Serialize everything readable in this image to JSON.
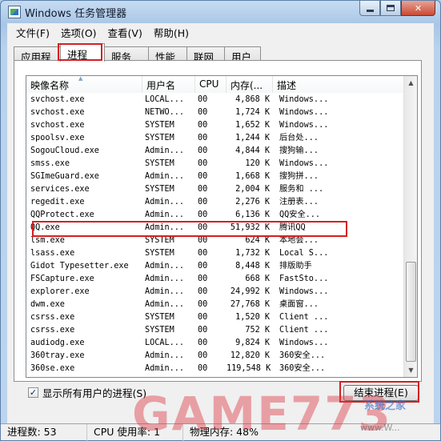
{
  "window": {
    "title": "Windows 任务管理器",
    "minimize_label": "",
    "close_label": "✕"
  },
  "menu": [
    "文件(F)",
    "选项(O)",
    "查看(V)",
    "帮助(H)"
  ],
  "tabs": [
    "应用程序",
    "进程",
    "服务",
    "性能",
    "联网",
    "用户"
  ],
  "active_tab": "进程",
  "columns": [
    "映像名称",
    "用户名",
    "CPU",
    "内存(...",
    "描述"
  ],
  "processes": [
    {
      "name": "svchost.exe",
      "user": "LOCAL...",
      "cpu": "00",
      "mem": "4,868 K",
      "desc": "Windows..."
    },
    {
      "name": "svchost.exe",
      "user": "NETWO...",
      "cpu": "00",
      "mem": "1,724 K",
      "desc": "Windows..."
    },
    {
      "name": "svchost.exe",
      "user": "SYSTEM",
      "cpu": "00",
      "mem": "1,652 K",
      "desc": "Windows..."
    },
    {
      "name": "spoolsv.exe",
      "user": "SYSTEM",
      "cpu": "00",
      "mem": "1,244 K",
      "desc": "后台处..."
    },
    {
      "name": "SogouCloud.exe",
      "user": "Admin...",
      "cpu": "00",
      "mem": "4,844 K",
      "desc": "搜狗输..."
    },
    {
      "name": "smss.exe",
      "user": "SYSTEM",
      "cpu": "00",
      "mem": "120 K",
      "desc": "Windows..."
    },
    {
      "name": "SGImeGuard.exe",
      "user": "Admin...",
      "cpu": "00",
      "mem": "1,668 K",
      "desc": "搜狗拼..."
    },
    {
      "name": "services.exe",
      "user": "SYSTEM",
      "cpu": "00",
      "mem": "2,004 K",
      "desc": "服务和 ..."
    },
    {
      "name": "regedit.exe",
      "user": "Admin...",
      "cpu": "00",
      "mem": "2,276 K",
      "desc": "注册表..."
    },
    {
      "name": "QQProtect.exe",
      "user": "Admin...",
      "cpu": "00",
      "mem": "6,136 K",
      "desc": "QQ安全..."
    },
    {
      "name": "QQ.exe",
      "user": "Admin...",
      "cpu": "00",
      "mem": "51,932 K",
      "desc": "腾讯QQ"
    },
    {
      "name": "lsm.exe",
      "user": "SYSTEM",
      "cpu": "00",
      "mem": "624 K",
      "desc": "本地会..."
    },
    {
      "name": "lsass.exe",
      "user": "SYSTEM",
      "cpu": "00",
      "mem": "1,732 K",
      "desc": "Local S..."
    },
    {
      "name": "Gidot Typesetter.exe",
      "user": "Admin...",
      "cpu": "00",
      "mem": "8,448 K",
      "desc": "排版助手"
    },
    {
      "name": "FSCapture.exe",
      "user": "Admin...",
      "cpu": "00",
      "mem": "668 K",
      "desc": "FastSto..."
    },
    {
      "name": "explorer.exe",
      "user": "Admin...",
      "cpu": "00",
      "mem": "24,992 K",
      "desc": "Windows..."
    },
    {
      "name": "dwm.exe",
      "user": "Admin...",
      "cpu": "00",
      "mem": "27,768 K",
      "desc": "桌面窗..."
    },
    {
      "name": "csrss.exe",
      "user": "SYSTEM",
      "cpu": "00",
      "mem": "1,520 K",
      "desc": "Client ..."
    },
    {
      "name": "csrss.exe",
      "user": "SYSTEM",
      "cpu": "00",
      "mem": "752 K",
      "desc": "Client ..."
    },
    {
      "name": "audiodg.exe",
      "user": "LOCAL...",
      "cpu": "00",
      "mem": "9,824 K",
      "desc": "Windows..."
    },
    {
      "name": "360tray.exe",
      "user": "Admin...",
      "cpu": "00",
      "mem": "12,820 K",
      "desc": "360安全..."
    },
    {
      "name": "360se.exe",
      "user": "Admin...",
      "cpu": "00",
      "mem": "119,548 K",
      "desc": "360安全..."
    }
  ],
  "highlighted_process": "services.exe",
  "show_all_users": {
    "label": "显示所有用户的进程(S)",
    "checked": true,
    "check_glyph": "✓"
  },
  "end_process_label": "结束进程(E)",
  "status": {
    "process_count": "进程数: 53",
    "cpu_usage": "CPU 使用率: 1",
    "memory": "物理内存: 48%"
  },
  "watermark": {
    "main": "GAME773",
    "sub": "系统之家",
    "url": "www.W..."
  },
  "colors": {
    "highlight_border": "#d42020",
    "watermark": "#dc3c46"
  },
  "icons": {
    "app": "task-manager-icon",
    "checkbox": "check-icon"
  }
}
